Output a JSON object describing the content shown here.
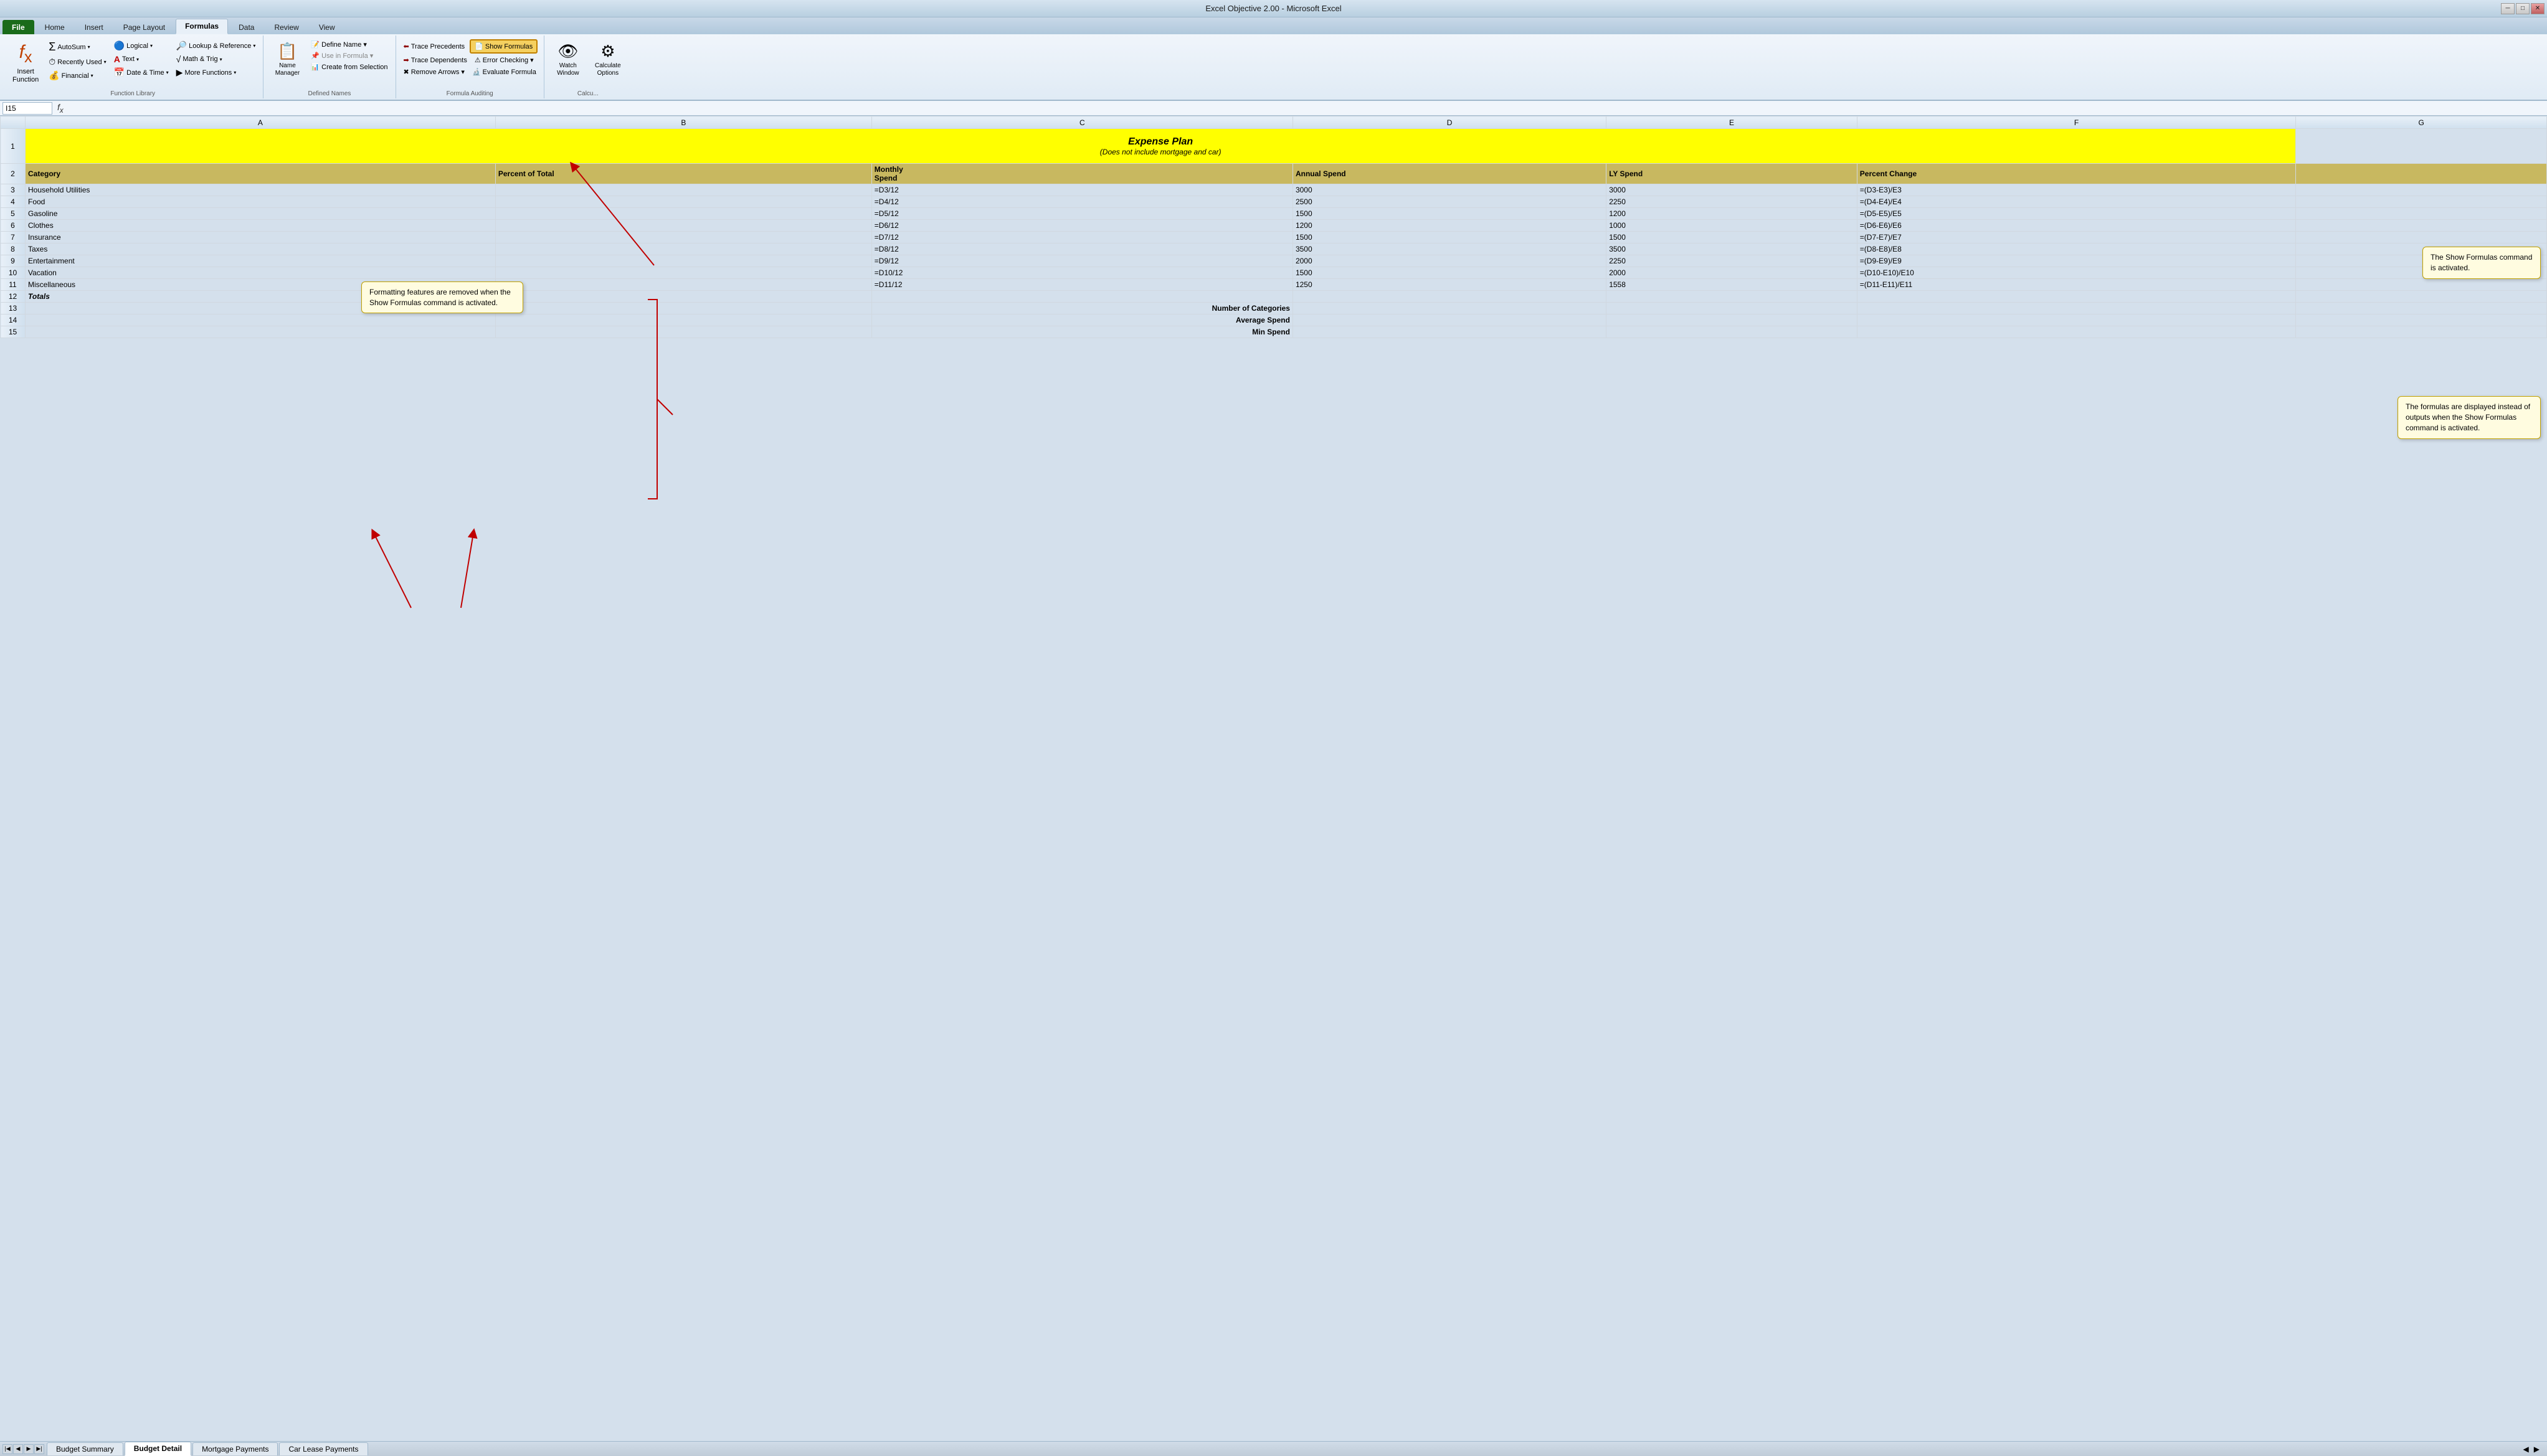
{
  "titleBar": {
    "title": "Excel Objective 2.00 - Microsoft Excel"
  },
  "tabs": [
    {
      "label": "File",
      "id": "file",
      "active": false,
      "isFile": true
    },
    {
      "label": "Home",
      "id": "home",
      "active": false
    },
    {
      "label": "Insert",
      "id": "insert",
      "active": false
    },
    {
      "label": "Page Layout",
      "id": "page-layout",
      "active": false
    },
    {
      "label": "Formulas",
      "id": "formulas",
      "active": true
    },
    {
      "label": "Data",
      "id": "data",
      "active": false
    },
    {
      "label": "Review",
      "id": "review",
      "active": false
    },
    {
      "label": "View",
      "id": "view",
      "active": false
    }
  ],
  "ribbonGroups": {
    "functionLibrary": {
      "label": "Function Library",
      "buttons": [
        {
          "id": "insert-function",
          "icon": "fx",
          "label": "Insert\nFunction",
          "isSpecial": true
        },
        {
          "id": "autosum",
          "icon": "∑",
          "label": "AutoSum",
          "hasDropdown": true
        },
        {
          "id": "recently-used",
          "icon": "🕐",
          "label": "Recently\nUsed",
          "hasDropdown": true
        },
        {
          "id": "financial",
          "icon": "💰",
          "label": "Financial",
          "hasDropdown": true
        },
        {
          "id": "logical",
          "icon": "?",
          "label": "Logical",
          "hasDropdown": true
        },
        {
          "id": "text",
          "icon": "A",
          "label": "Text",
          "hasDropdown": true
        },
        {
          "id": "date-time",
          "icon": "📅",
          "label": "Date &\nTime",
          "hasDropdown": true
        },
        {
          "id": "lookup-reference",
          "icon": "🔍",
          "label": "Lookup &\nReference",
          "hasDropdown": true
        },
        {
          "id": "math-trig",
          "icon": "√",
          "label": "Math &\nTrig",
          "hasDropdown": true
        },
        {
          "id": "more-functions",
          "icon": "▶",
          "label": "More\nFunctions",
          "hasDropdown": true
        }
      ]
    },
    "definedNames": {
      "label": "Defined Names",
      "buttons": [
        {
          "id": "name-manager",
          "icon": "📋",
          "label": "Name\nManager"
        },
        {
          "id": "define-name",
          "label": "Define Name ▾"
        },
        {
          "id": "use-in-formula",
          "label": "Use in Formula ▾"
        },
        {
          "id": "create-from-selection",
          "label": "Create from Selection"
        }
      ]
    },
    "formulaAuditing": {
      "label": "Formula Auditing",
      "buttons": [
        {
          "id": "trace-precedents",
          "label": "Trace Precedents"
        },
        {
          "id": "trace-dependents",
          "label": "Trace Dependents"
        },
        {
          "id": "remove-arrows",
          "label": "Remove Arrows ▾"
        },
        {
          "id": "show-formulas",
          "label": "Show Formulas",
          "active": true
        },
        {
          "id": "error-checking",
          "label": "Error Checking ▾"
        },
        {
          "id": "evaluate-formula",
          "label": "Evaluate Formula"
        }
      ]
    },
    "calculation": {
      "label": "Calcu...",
      "buttons": [
        {
          "id": "watch-window",
          "label": "Watch\nWindow"
        },
        {
          "id": "calculate-options",
          "label": "Calculate\nOptions"
        }
      ]
    }
  },
  "formulaBar": {
    "nameBox": "I15",
    "fx": "fx",
    "formula": ""
  },
  "columnHeaders": [
    "",
    "A",
    "B",
    "C",
    "D",
    "E",
    "F",
    "G"
  ],
  "rows": [
    {
      "rowNum": "",
      "cells": [
        "",
        "",
        "",
        "",
        "",
        "",
        "",
        ""
      ]
    },
    {
      "rowNum": "1",
      "isTitle": true,
      "cells": [
        "Expense Plan",
        "(Does not include mortgage and car)",
        "",
        "",
        "",
        ""
      ]
    },
    {
      "rowNum": "2",
      "isHeader": true,
      "cells": [
        "Category",
        "Percent of Total",
        "Monthly\nSpend",
        "Annual Spend",
        "LY Spend",
        "Percent Change",
        ""
      ]
    },
    {
      "rowNum": "3",
      "cells": [
        "Household Utilities",
        "",
        "=D3/12",
        "3000",
        "3000",
        "=(D3-E3)/E3",
        ""
      ]
    },
    {
      "rowNum": "4",
      "cells": [
        "Food",
        "",
        "=D4/12",
        "2500",
        "2250",
        "=(D4-E4)/E4",
        ""
      ]
    },
    {
      "rowNum": "5",
      "cells": [
        "Gasoline",
        "",
        "=D5/12",
        "1500",
        "1200",
        "=(D5-E5)/E5",
        ""
      ]
    },
    {
      "rowNum": "6",
      "cells": [
        "Clothes",
        "",
        "=D6/12",
        "1200",
        "1000",
        "=(D6-E6)/E6",
        ""
      ]
    },
    {
      "rowNum": "7",
      "cells": [
        "Insurance",
        "",
        "=D7/12",
        "1500",
        "1500",
        "=(D7-E7)/E7",
        ""
      ]
    },
    {
      "rowNum": "8",
      "cells": [
        "Taxes",
        "",
        "=D8/12",
        "3500",
        "3500",
        "=(D8-E8)/E8",
        ""
      ]
    },
    {
      "rowNum": "9",
      "cells": [
        "Entertainment",
        "",
        "=D9/12",
        "2000",
        "2250",
        "=(D9-E9)/E9",
        ""
      ]
    },
    {
      "rowNum": "10",
      "cells": [
        "Vacation",
        "",
        "=D10/12",
        "1500",
        "2000",
        "=(D10-E10)/E10",
        ""
      ]
    },
    {
      "rowNum": "11",
      "cells": [
        "Miscellaneous",
        "",
        "=D11/12",
        "1250",
        "1558",
        "=(D11-E11)/E11",
        ""
      ]
    },
    {
      "rowNum": "12",
      "isBold": true,
      "cells": [
        "Totals",
        "",
        "",
        "",
        "",
        "",
        ""
      ]
    },
    {
      "rowNum": "13",
      "cells": [
        "",
        "",
        "Number of Categories",
        "",
        "",
        "",
        ""
      ]
    },
    {
      "rowNum": "14",
      "cells": [
        "",
        "",
        "Average Spend",
        "",
        "",
        "",
        ""
      ]
    },
    {
      "rowNum": "15",
      "cells": [
        "",
        "",
        "Min Spend",
        "",
        "",
        "",
        ""
      ]
    }
  ],
  "callouts": [
    {
      "id": "show-formulas-callout",
      "text": "The Show Formulas command is activated.",
      "style": "top: 218px; right: 20px; max-width: 190px;"
    },
    {
      "id": "formulas-displayed-callout",
      "text": "The formulas are displayed instead of outputs when the Show Formulas command is activated.",
      "style": "top: 470px; right: 20px; max-width: 220px;"
    },
    {
      "id": "formatting-removed-callout",
      "text": "Formatting features are removed when the Show Formulas command is activated.",
      "style": "bottom: 60px; left: 580px; max-width: 240px;"
    }
  ],
  "sheetTabs": [
    {
      "label": "Budget Summary",
      "active": false
    },
    {
      "label": "Budget Detail",
      "active": true
    },
    {
      "label": "Mortgage Payments",
      "active": false
    },
    {
      "label": "Car Lease Payments",
      "active": false
    }
  ]
}
